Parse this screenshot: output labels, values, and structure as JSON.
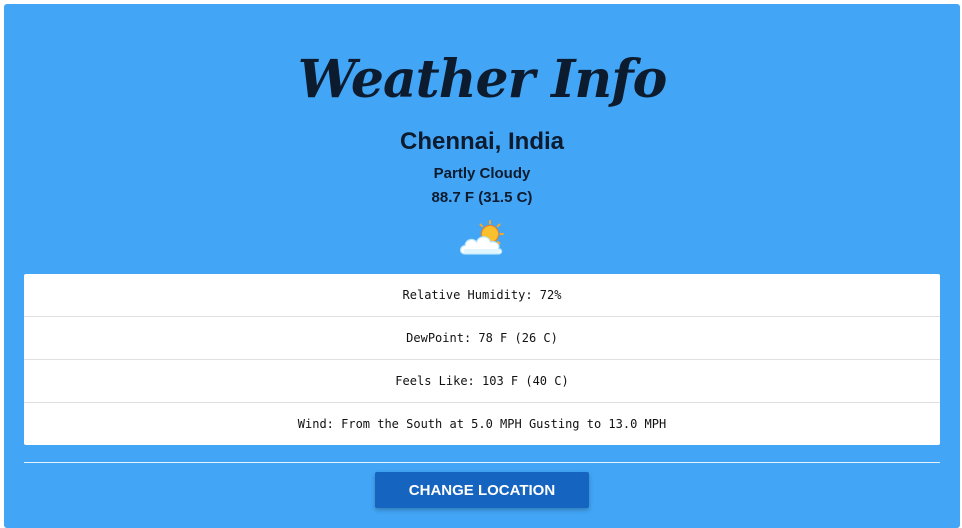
{
  "header": {
    "title": "Weather Info"
  },
  "current": {
    "location": "Chennai, India",
    "condition": "Partly Cloudy",
    "temperature": "88.7 F (31.5 C)",
    "icon": "partly-cloudy-icon"
  },
  "details": {
    "items": [
      "Relative Humidity: 72%",
      "DewPoint: 78 F (26 C)",
      "Feels Like: 103 F (40 C)",
      "Wind: From the South at 5.0 MPH Gusting to 13.0 MPH"
    ]
  },
  "actions": {
    "change_location_label": "CHANGE LOCATION"
  },
  "colors": {
    "background": "#42a5f5",
    "button": "#1565c0",
    "text": "#0d1b2e"
  }
}
